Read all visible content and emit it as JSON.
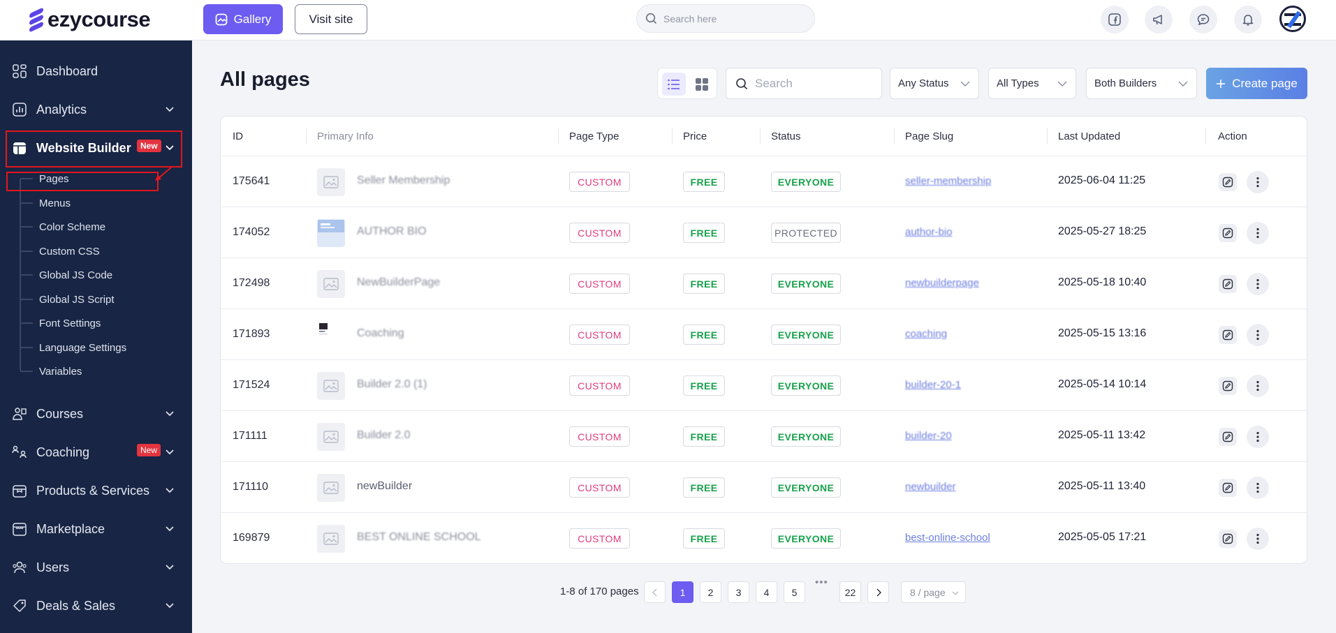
{
  "brand": {
    "name": "ezycourse"
  },
  "topbar": {
    "gallery_label": "Gallery",
    "visit_label": "Visit site",
    "search_placeholder": "Search here"
  },
  "sidebar": {
    "items": [
      {
        "label": "Dashboard",
        "icon": "dashboard-icon"
      },
      {
        "label": "Analytics",
        "icon": "analytics-icon"
      },
      {
        "label": "Website Builder",
        "icon": "website-builder-icon",
        "badge": "New"
      },
      {
        "label": "Courses",
        "icon": "courses-icon"
      },
      {
        "label": "Coaching",
        "icon": "coaching-icon",
        "badge": "New"
      },
      {
        "label": "Products & Services",
        "icon": "products-icon"
      },
      {
        "label": "Marketplace",
        "icon": "marketplace-icon"
      },
      {
        "label": "Users",
        "icon": "users-icon"
      },
      {
        "label": "Deals & Sales",
        "icon": "deals-icon"
      }
    ],
    "subitems": [
      "Pages",
      "Menus",
      "Color Scheme",
      "Custom CSS",
      "Global JS Code",
      "Global JS Script",
      "Font Settings",
      "Language Settings",
      "Variables"
    ]
  },
  "main": {
    "title": "All pages",
    "search_placeholder": "Search",
    "filters": {
      "status": "Any Status",
      "types": "All Types",
      "builders": "Both Builders"
    },
    "create_label": "Create page",
    "columns": [
      "ID",
      "Primary Info",
      "Page Type",
      "Price",
      "Status",
      "Page Slug",
      "Last Updated",
      "Action"
    ],
    "rows": [
      {
        "id": "175641",
        "name": "Seller Membership",
        "type": "CUSTOM",
        "price": "FREE",
        "status": "EVERYONE",
        "slug": "seller-membership",
        "updated": "2025-06-04 11:25"
      },
      {
        "id": "174052",
        "name": "AUTHOR BIO",
        "type": "CUSTOM",
        "price": "FREE",
        "status": "PROTECTED",
        "slug": "author-bio",
        "updated": "2025-05-27 18:25"
      },
      {
        "id": "172498",
        "name": "NewBuilderPage",
        "type": "CUSTOM",
        "price": "FREE",
        "status": "EVERYONE",
        "slug": "newbuilderpage",
        "updated": "2025-05-18 10:40"
      },
      {
        "id": "171893",
        "name": "Coaching",
        "type": "CUSTOM",
        "price": "FREE",
        "status": "EVERYONE",
        "slug": "coaching",
        "updated": "2025-05-15 13:16"
      },
      {
        "id": "171524",
        "name": "Builder 2.0 (1)",
        "type": "CUSTOM",
        "price": "FREE",
        "status": "EVERYONE",
        "slug": "builder-20-1",
        "updated": "2025-05-14 10:14"
      },
      {
        "id": "171111",
        "name": "Builder 2.0",
        "type": "CUSTOM",
        "price": "FREE",
        "status": "EVERYONE",
        "slug": "builder-20",
        "updated": "2025-05-11 13:42"
      },
      {
        "id": "171110",
        "name": "newBuilder",
        "type": "CUSTOM",
        "price": "FREE",
        "status": "EVERYONE",
        "slug": "newbuilder",
        "updated": "2025-05-11 13:40"
      },
      {
        "id": "169879",
        "name": "BEST ONLINE SCHOOL",
        "type": "CUSTOM",
        "price": "FREE",
        "status": "EVERYONE",
        "slug": "best-online-school",
        "updated": "2025-05-05 17:21"
      }
    ]
  },
  "pagination": {
    "info": "1-8 of 170 pages",
    "pages": [
      "1",
      "2",
      "3",
      "4",
      "5"
    ],
    "dots": "•••",
    "last": "22",
    "page_size": "8 / page",
    "current": "1"
  },
  "colors": {
    "accent": "#6c5cf0",
    "sidebar": "#182544",
    "custom": "#e23b7a",
    "free": "#17a14b",
    "highlight": "#e3161c"
  }
}
